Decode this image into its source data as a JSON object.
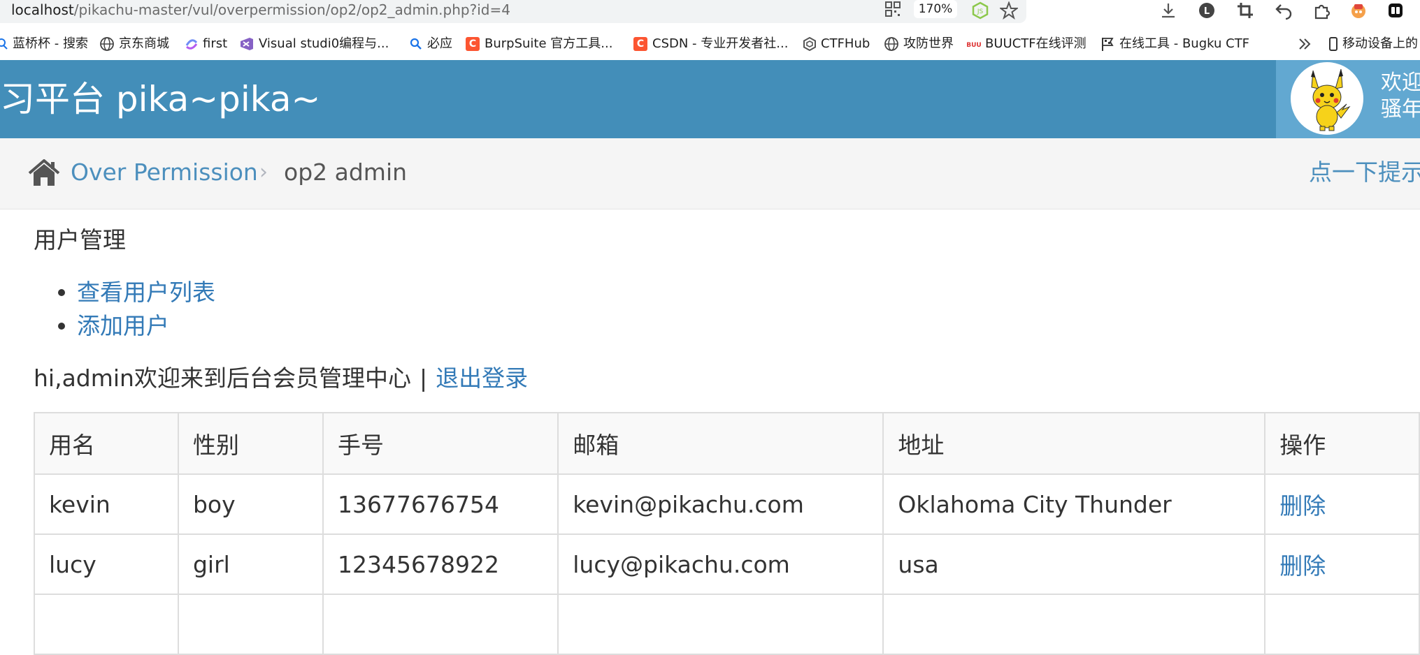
{
  "browser": {
    "url_host": "localhost",
    "url_path": "/pikachu-master/vul/overpermission/op2/op2_admin.php?id=4",
    "zoom": "170%",
    "icons": [
      "qr-code-icon",
      "node-js-icon",
      "star-icon",
      "download-icon",
      "profile-icon",
      "crop-icon",
      "undo-icon",
      "extensions-icon",
      "game-icon",
      "menu-icon"
    ],
    "bookmarks": [
      "蓝桥杯 - 搜索",
      "京东商城",
      "first",
      "Visual studi0编程与...",
      "必应",
      "BurpSuite 官方工具...",
      "CSDN - 专业开发者社...",
      "CTFHub",
      "攻防世界",
      "BUUCTF在线评测",
      "在线工具 - Bugku CTF",
      "移动设备上的"
    ]
  },
  "header": {
    "title": "习平台 pika~pika~",
    "welcome_line1": "欢迎",
    "welcome_line2": "骚年"
  },
  "breadcrumb": {
    "parent": "Over Permission",
    "separator": "›",
    "current": "op2 admin",
    "hint": "点一下提示"
  },
  "content": {
    "section_title": "用户管理",
    "menu": [
      "查看用户列表",
      "添加用户"
    ],
    "greeting": "hi,admin欢迎来到后台会员管理中心",
    "greeting_sep": "|",
    "logout": "退出登录"
  },
  "table": {
    "headers": [
      "用名",
      "性别",
      "手号",
      "邮箱",
      "地址",
      "操作"
    ],
    "rows": [
      [
        "kevin",
        "boy",
        "13677676754",
        "kevin@pikachu.com",
        "Oklahoma City Thunder",
        "删除"
      ],
      [
        "lucy",
        "girl",
        "12345678922",
        "lucy@pikachu.com",
        "usa",
        "删除"
      ]
    ]
  },
  "colors": {
    "header_bg": "#438eb9",
    "user_box_bg": "#62a8d1",
    "link": "#337ab7",
    "breadcrumb_bg": "#f5f5f5"
  }
}
